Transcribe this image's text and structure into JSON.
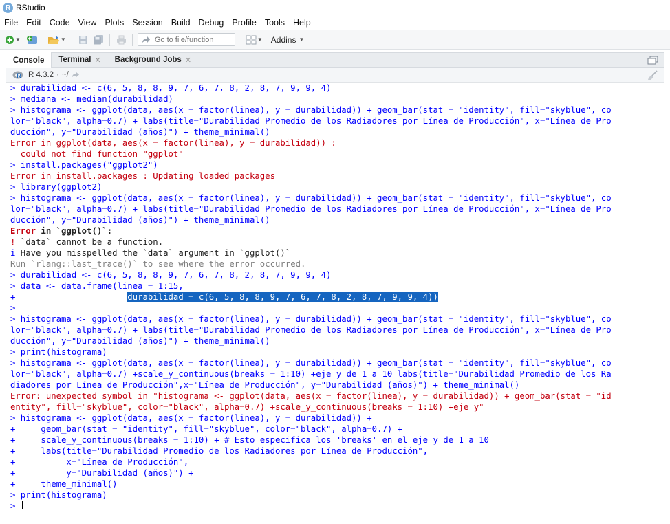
{
  "window": {
    "title": "RStudio",
    "logo_letter": "R"
  },
  "menubar": {
    "items": [
      "File",
      "Edit",
      "Code",
      "View",
      "Plots",
      "Session",
      "Build",
      "Debug",
      "Profile",
      "Tools",
      "Help"
    ]
  },
  "toolbar": {
    "goto_placeholder": "Go to file/function",
    "addins_label": "Addins"
  },
  "tabs": [
    {
      "label": "Console",
      "active": true
    },
    {
      "label": "Terminal"
    },
    {
      "label": "Background Jobs"
    }
  ],
  "console_header": {
    "version": "R 4.3.2",
    "path": "~/"
  },
  "console_lines": [
    [
      {
        "t": "> durabilidad <- c(6, 5, 8, 8, 9, 7, 6, 7, 8, 2, 8, 7, 9, 9, 4)",
        "c": "in"
      }
    ],
    [
      {
        "t": "> mediana <- median(durabilidad)",
        "c": "in"
      }
    ],
    [
      {
        "t": "> histograma <- ggplot(data, aes(x = factor(linea), y = durabilidad)) + geom_bar(stat = \"identity\", fill=\"skyblue\", co",
        "c": "in"
      }
    ],
    [
      {
        "t": "lor=\"black\", alpha=0.7) + labs(title=\"Durabilidad Promedio de los Radiadores por Línea de Producción\", x=\"Línea de Pro",
        "c": "in"
      }
    ],
    [
      {
        "t": "ducción\", y=\"Durabilidad (años)\") + theme_minimal()",
        "c": "in"
      }
    ],
    [
      {
        "t": "Error in ggplot(data, aes(x = factor(linea), y = durabilidad)) : ",
        "c": "err"
      }
    ],
    [
      {
        "t": "  could not find function \"ggplot\"",
        "c": "err"
      }
    ],
    [
      {
        "t": "> install.packages(\"ggplot2\")",
        "c": "in"
      }
    ],
    [
      {
        "t": "Error in install.packages : Updating loaded packages",
        "c": "err"
      }
    ],
    [
      {
        "t": "> library(ggplot2)",
        "c": "in"
      }
    ],
    [
      {
        "t": "> histograma <- ggplot(data, aes(x = factor(linea), y = durabilidad)) + geom_bar(stat = \"identity\", fill=\"skyblue\", co",
        "c": "in"
      }
    ],
    [
      {
        "t": "lor=\"black\", alpha=0.7) + labs(title=\"Durabilidad Promedio de los Radiadores por Línea de Producción\", x=\"Línea de Pro",
        "c": "in"
      }
    ],
    [
      {
        "t": "ducción\", y=\"Durabilidad (años)\") + theme_minimal()",
        "c": "in"
      }
    ],
    [
      {
        "t": "Error",
        "c": "err bold"
      },
      {
        "t": " in `ggplot()`:",
        "c": "bold"
      }
    ],
    [
      {
        "t": "!",
        "c": "err"
      },
      {
        "t": " `data` cannot be a function."
      }
    ],
    [
      {
        "t": "i",
        "c": "in"
      },
      {
        "t": " Have you misspelled the `data` argument in `ggplot()`"
      }
    ],
    [
      {
        "t": "Run `",
        "c": "grey"
      },
      {
        "t": "rlang::last_trace()",
        "c": "grey ul"
      },
      {
        "t": "` to see where the error occurred.",
        "c": "grey"
      }
    ],
    [
      {
        "t": "> durabilidad <- c(6, 5, 8, 8, 9, 7, 6, 7, 8, 2, 8, 7, 9, 9, 4)",
        "c": "in"
      }
    ],
    [
      {
        "t": "> data <- data.frame(linea = 1:15,",
        "c": "in"
      }
    ],
    [
      {
        "t": "+                      ",
        "c": "in"
      },
      {
        "t": "durabilidad = c(6, 5, 8, 8, 9, 7, 6, 7, 8, 2, 8, 7, 9, 9, 4))",
        "c": "hl"
      }
    ],
    [
      {
        "t": ">",
        "c": "in"
      }
    ],
    [
      {
        "t": "> histograma <- ggplot(data, aes(x = factor(linea), y = durabilidad)) + geom_bar(stat = \"identity\", fill=\"skyblue\", co",
        "c": "in"
      }
    ],
    [
      {
        "t": "lor=\"black\", alpha=0.7) + labs(title=\"Durabilidad Promedio de los Radiadores por Línea de Producción\", x=\"Línea de Pro",
        "c": "in"
      }
    ],
    [
      {
        "t": "ducción\", y=\"Durabilidad (años)\") + theme_minimal()",
        "c": "in"
      }
    ],
    [
      {
        "t": "> print(histograma)",
        "c": "in"
      }
    ],
    [
      {
        "t": "> histograma <- ggplot(data, aes(x = factor(linea), y = durabilidad)) + geom_bar(stat = \"identity\", fill=\"skyblue\", co",
        "c": "in"
      }
    ],
    [
      {
        "t": "lor=\"black\", alpha=0.7) +scale_y_continuous(breaks = 1:10) +eje y de 1 a 10 labs(title=\"Durabilidad Promedio de los Ra",
        "c": "in"
      }
    ],
    [
      {
        "t": "diadores por Línea de Producción\",x=\"Línea de Producción\", y=\"Durabilidad (años)\") + theme_minimal()",
        "c": "in"
      }
    ],
    [
      {
        "t": "Error: unexpected symbol in \"histograma <- ggplot(data, aes(x = factor(linea), y = durabilidad)) + geom_bar(stat = \"id",
        "c": "err"
      }
    ],
    [
      {
        "t": "entity\", fill=\"skyblue\", color=\"black\", alpha=0.7) +scale_y_continuous(breaks = 1:10) +eje y\"",
        "c": "err"
      }
    ],
    [
      {
        "t": "> histograma <- ggplot(data, aes(x = factor(linea), y = durabilidad)) +",
        "c": "in"
      }
    ],
    [
      {
        "t": "+     geom_bar(stat = \"identity\", fill=\"skyblue\", color=\"black\", alpha=0.7) +",
        "c": "in"
      }
    ],
    [
      {
        "t": "+     scale_y_continuous(breaks = 1:10) + # Esto especifica los 'breaks' en el eje y de 1 a 10",
        "c": "in"
      }
    ],
    [
      {
        "t": "+     labs(title=\"Durabilidad Promedio de los Radiadores por Línea de Producción\",",
        "c": "in"
      }
    ],
    [
      {
        "t": "+          x=\"Línea de Producción\",",
        "c": "in"
      }
    ],
    [
      {
        "t": "+          y=\"Durabilidad (años)\") +",
        "c": "in"
      }
    ],
    [
      {
        "t": "+     theme_minimal()",
        "c": "in"
      }
    ],
    [
      {
        "t": "> print(histograma)",
        "c": "in"
      }
    ],
    [
      {
        "t": "> ",
        "c": "in"
      }
    ]
  ]
}
